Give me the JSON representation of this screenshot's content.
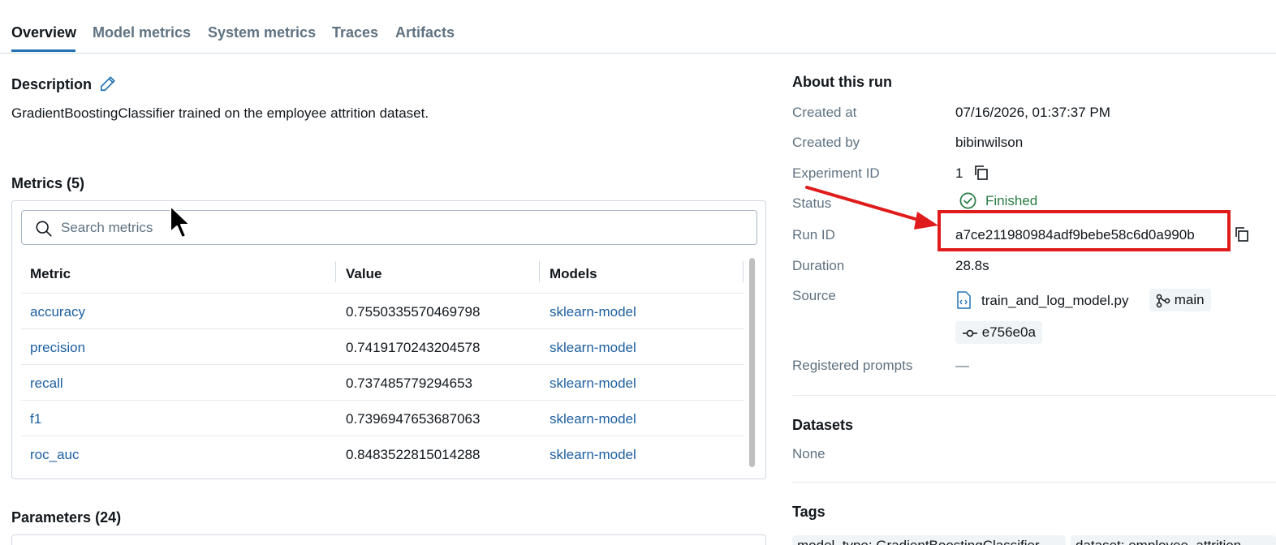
{
  "tabs": [
    {
      "label": "Overview",
      "active": true
    },
    {
      "label": "Model metrics"
    },
    {
      "label": "System metrics"
    },
    {
      "label": "Traces"
    },
    {
      "label": "Artifacts"
    }
  ],
  "description": {
    "title": "Description",
    "text": "GradientBoostingClassifier trained on the employee attrition dataset."
  },
  "metrics": {
    "title": "Metrics (5)",
    "search_placeholder": "Search metrics",
    "columns": [
      "Metric",
      "Value",
      "Models"
    ],
    "rows": [
      {
        "metric": "accuracy",
        "value": "0.7550335570469798",
        "model": "sklearn-model"
      },
      {
        "metric": "precision",
        "value": "0.7419170243204578",
        "model": "sklearn-model"
      },
      {
        "metric": "recall",
        "value": "0.737485779294653",
        "model": "sklearn-model"
      },
      {
        "metric": "f1",
        "value": "0.7396947653687063",
        "model": "sklearn-model"
      },
      {
        "metric": "roc_auc",
        "value": "0.8483522815014288",
        "model": "sklearn-model"
      }
    ]
  },
  "parameters": {
    "title": "Parameters (24)"
  },
  "about": {
    "title": "About this run",
    "created_at_label": "Created at",
    "created_at": "07/16/2026, 01:37:37 PM",
    "created_by_label": "Created by",
    "created_by": "bibinwilson",
    "experiment_id_label": "Experiment ID",
    "experiment_id": "1",
    "status_label": "Status",
    "status": "Finished",
    "run_id_label": "Run ID",
    "run_id": "a7ce211980984adf9bebe58c6d0a990b",
    "duration_label": "Duration",
    "duration": "28.8s",
    "source_label": "Source",
    "source_file": "train_and_log_model.py",
    "source_branch": "main",
    "source_commit": "e756e0a",
    "registered_prompts_label": "Registered prompts",
    "registered_prompts": "—"
  },
  "datasets": {
    "title": "Datasets",
    "value": "None"
  },
  "tags": {
    "title": "Tags",
    "items": [
      "model_type: GradientBoostingClassifier",
      "dataset: employee_attrition"
    ]
  },
  "colors": {
    "accent": "#2272b4",
    "link": "#1d5fa0",
    "success": "#277c43",
    "highlight": "#e01b1b"
  }
}
